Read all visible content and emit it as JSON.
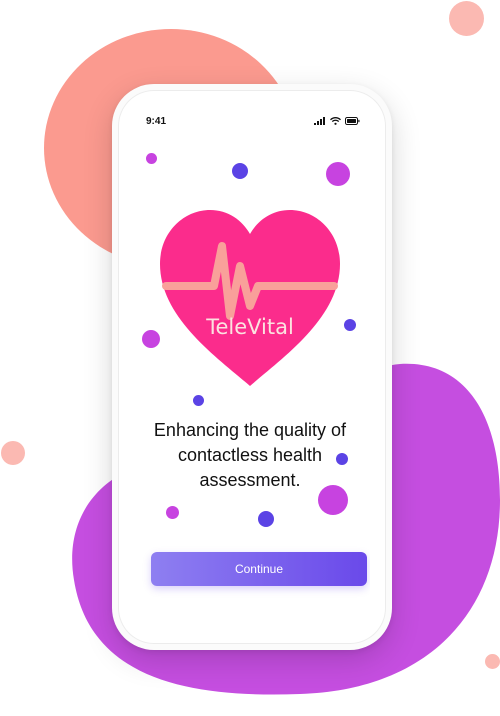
{
  "status_bar": {
    "time": "9:41",
    "icons": [
      "cellular-signal-icon",
      "wifi-icon",
      "battery-icon"
    ]
  },
  "app": {
    "name": "TeleVital",
    "tagline_lines": [
      "Enhancing the quality of",
      "contactless health",
      "assessment."
    ],
    "continue_label": "Continue"
  },
  "colors": {
    "heart": "#fb2c8c",
    "heartbeat_line": "#f9a09a",
    "button_start": "#8e7ff1",
    "button_end": "#6a49ea",
    "bubble_magenta": "#c743e0",
    "bubble_indigo": "#5b43e5",
    "backdrop_coral": "#fb9a8f",
    "backdrop_purple": "#c54ee0"
  }
}
